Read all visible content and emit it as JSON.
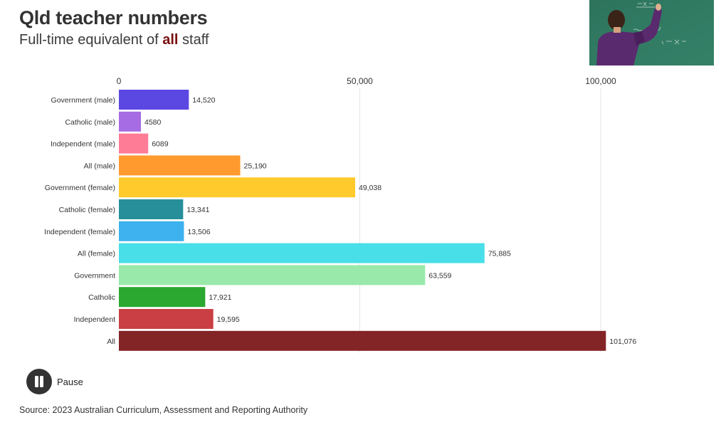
{
  "header": {
    "title": "Qld teacher numbers",
    "subtitle_pre": "Full-time equivalent of ",
    "subtitle_highlight": "all",
    "subtitle_post": " staff",
    "highlight_color": "#7a0f0f",
    "image_alt": "Teacher writing on chalkboard"
  },
  "controls": {
    "pause_label": "Pause",
    "pause_icon": "pause-icon"
  },
  "footer": {
    "source": "Source: 2023 Australian Curriculum, Assessment and Reporting Authority"
  },
  "chart_data": {
    "type": "bar",
    "orientation": "horizontal",
    "title": "Qld teacher numbers",
    "subtitle": "Full-time equivalent of all staff",
    "xlabel": "",
    "ylabel": "",
    "xlim": [
      0,
      110000
    ],
    "x_ticks": [
      0,
      50000,
      100000
    ],
    "x_tick_labels": [
      "0",
      "50,000",
      "100,000"
    ],
    "x_axis_position": "top",
    "grid": true,
    "categories": [
      "Government (male)",
      "Catholic (male)",
      "Independent (male)",
      "All (male)",
      "Government (female)",
      "Catholic (female)",
      "Independent (female)",
      "All (female)",
      "Government",
      "Catholic",
      "Independent",
      "All"
    ],
    "values": [
      14520,
      4580,
      6089,
      25190,
      49038,
      13341,
      13506,
      75885,
      63559,
      17921,
      19595,
      101076
    ],
    "value_labels": [
      "14,520",
      "4580",
      "6089",
      "25,190",
      "49,038",
      "13,341",
      "13,506",
      "75,885",
      "63,559",
      "17,921",
      "19,595",
      "101,076"
    ],
    "colors": [
      "#5b48e3",
      "#a66ce3",
      "#ff7c96",
      "#ff9a2e",
      "#ffca2c",
      "#268f9a",
      "#3db2ee",
      "#48dfe8",
      "#98e9aa",
      "#2aa82f",
      "#c93f44",
      "#832427"
    ]
  }
}
